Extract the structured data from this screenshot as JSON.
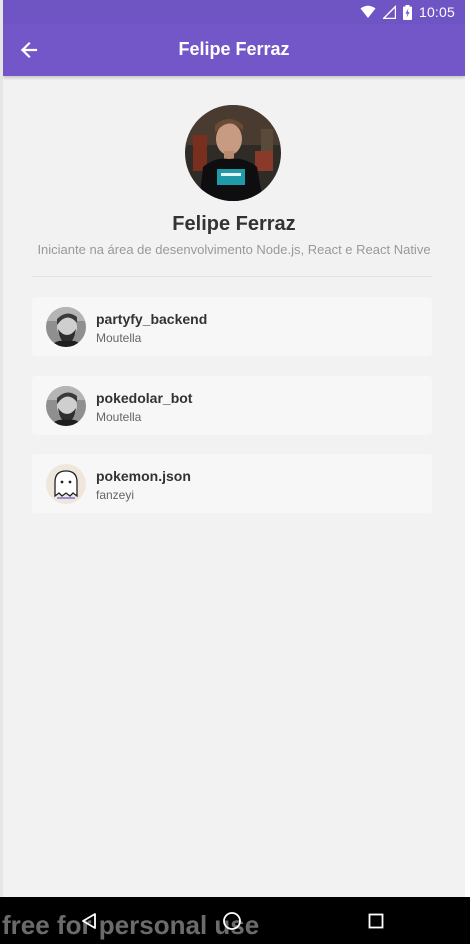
{
  "status_bar": {
    "time": "10:05",
    "icons": [
      "wifi-icon",
      "signal-icon",
      "battery-charging-icon"
    ]
  },
  "app_bar": {
    "title": "Felipe Ferraz",
    "back_icon": "arrow-left-icon",
    "color": "#7357c8"
  },
  "profile": {
    "name": "Felipe Ferraz",
    "bio": "Iniciante na área de desenvolvimento Node.js, React e React Native"
  },
  "repositories": [
    {
      "name": "partyfy_backend",
      "owner": "Moutella",
      "avatar": "bearded-man-avatar"
    },
    {
      "name": "pokedolar_bot",
      "owner": "Moutella",
      "avatar": "bearded-man-avatar"
    },
    {
      "name": "pokemon.json",
      "owner": "fanzeyi",
      "avatar": "ghost-avatar"
    }
  ],
  "nav_bar": {
    "buttons": [
      "back-triangle-icon",
      "home-circle-icon",
      "recents-square-icon"
    ]
  },
  "watermark": "free for personal use"
}
